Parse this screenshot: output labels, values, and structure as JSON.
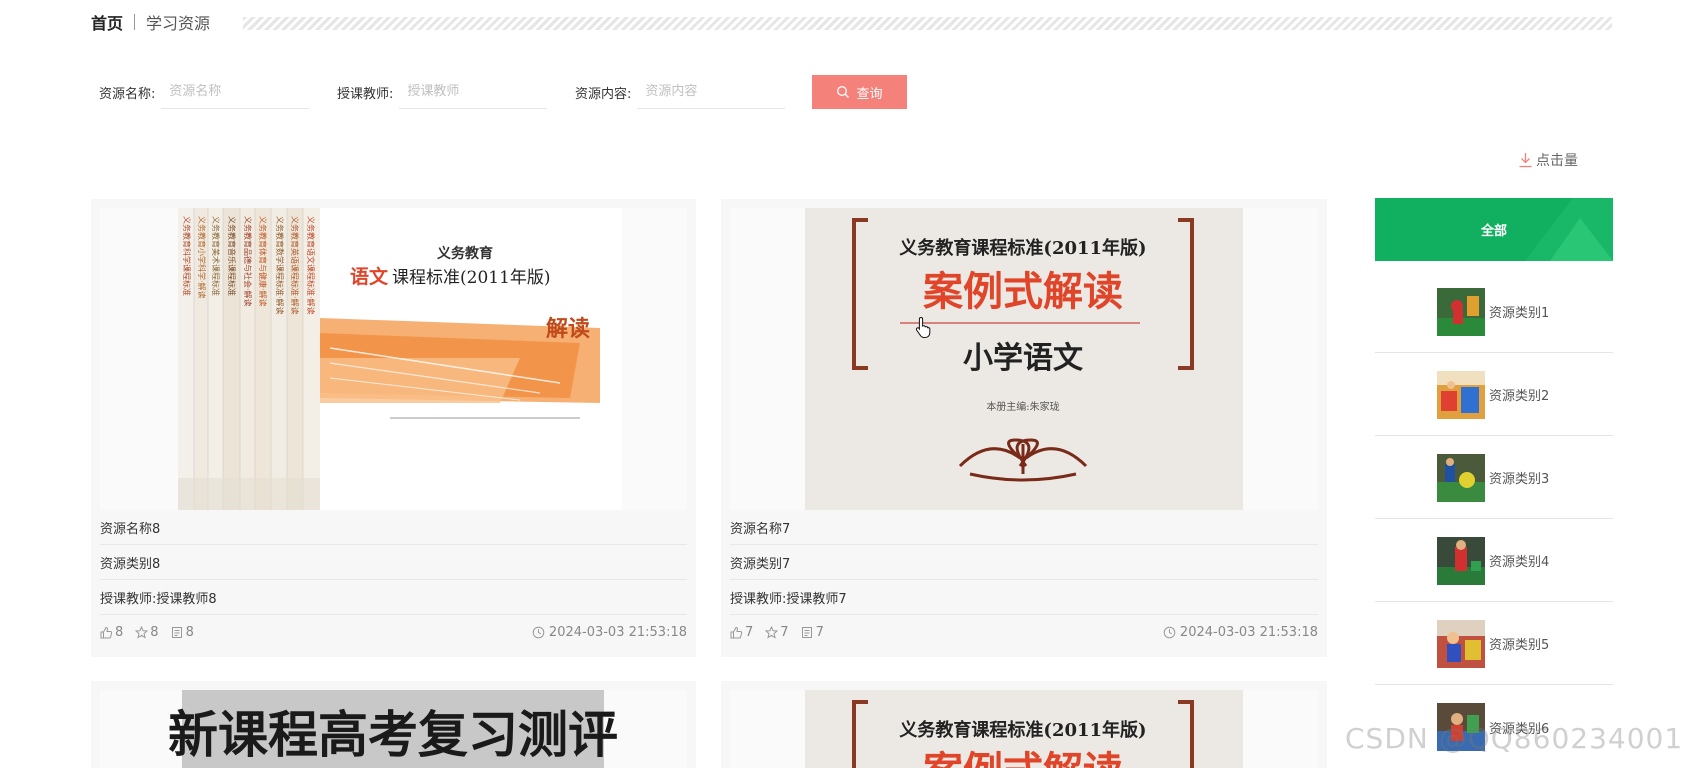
{
  "breadcrumb": {
    "home": "首页",
    "current": "学习资源"
  },
  "search": {
    "fields": [
      {
        "label": "资源名称:",
        "placeholder": "资源名称",
        "value": ""
      },
      {
        "label": "授课教师:",
        "placeholder": "授课教师",
        "value": ""
      },
      {
        "label": "资源内容:",
        "placeholder": "资源内容",
        "value": ""
      }
    ],
    "button_label": "查询"
  },
  "sort": {
    "label": "点击量"
  },
  "cards": [
    {
      "name": "资源名称8",
      "category": "资源类别8",
      "teacher": "授课教师:授课教师8",
      "likes": "8",
      "favorites": "8",
      "comments": "8",
      "time": "2024-03-03 21:53:18",
      "cover": {
        "main_small": "义务教育",
        "main_title_red": "语文",
        "main_title_rest": "课程标准(2011年版)",
        "badge": "解读",
        "spines": [
          "义务教育语文课程标准·解读",
          "义务教育英语课程标准·解读",
          "义务教育数学课程标准·解读",
          "义务教育体育与健康·解读",
          "义务教育品德与社会·解读",
          "义务教育音乐课程标准",
          "义务教育美术课程标准",
          "义务教育小学科学·解读",
          "义务教育科学课程标准"
        ]
      }
    },
    {
      "name": "资源名称7",
      "category": "资源类别7",
      "teacher": "授课教师:授课教师7",
      "likes": "7",
      "favorites": "7",
      "comments": "7",
      "time": "2024-03-03 21:53:18",
      "cover": {
        "line1": "义务教育课程标准(2011年版)",
        "line2": "案例式解读",
        "line3": "小学语文",
        "line4": "本册主编:朱家珑"
      }
    },
    {
      "cover": {
        "line1": "新课程高考复习测评"
      }
    },
    {
      "cover": {
        "line1": "义务教育课程标准(2011年版)",
        "line2": "案例式解读"
      }
    }
  ],
  "sidebar": {
    "all_label": "全部",
    "items": [
      {
        "label": "资源类别1"
      },
      {
        "label": "资源类别2"
      },
      {
        "label": "资源类别3"
      },
      {
        "label": "资源类别4"
      },
      {
        "label": "资源类别5"
      },
      {
        "label": "资源类别6"
      }
    ]
  },
  "watermark": "CSDN @QQ860234001",
  "colors": {
    "accent": "#f4817a",
    "green": "#10b060",
    "title_red": "#e0452a"
  }
}
